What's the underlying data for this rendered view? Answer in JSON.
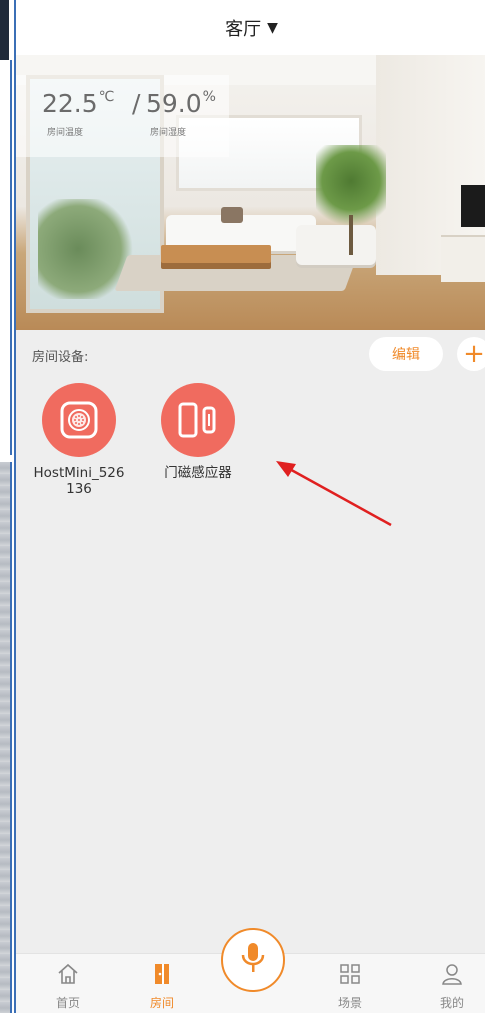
{
  "header": {
    "room_name": "客厅",
    "dropdown_icon": "caret-down-icon"
  },
  "climate": {
    "temperature": "22.5",
    "temperature_unit": "℃",
    "separator": "/",
    "humidity": "59.0",
    "humidity_unit": "%",
    "temperature_label": "房间温度",
    "humidity_label": "房间湿度"
  },
  "devices_section": {
    "label": "房间设备:",
    "edit_label": "编辑",
    "add_label": "+",
    "devices": [
      {
        "name": "HostMini_526136",
        "icon": "hub-speaker-icon"
      },
      {
        "name": "门磁感应器",
        "icon": "door-sensor-icon"
      }
    ]
  },
  "nav": {
    "items": [
      {
        "label": "首页",
        "icon": "home-icon",
        "active": false
      },
      {
        "label": "房间",
        "icon": "door-icon",
        "active": true
      },
      {
        "label": "场景",
        "icon": "grid-icon",
        "active": false
      },
      {
        "label": "我的",
        "icon": "user-icon",
        "active": false
      }
    ],
    "center_icon": "microphone-icon"
  },
  "colors": {
    "accent": "#f08a2a",
    "device_bg": "#f06b5f",
    "annotation": "#e02020"
  }
}
